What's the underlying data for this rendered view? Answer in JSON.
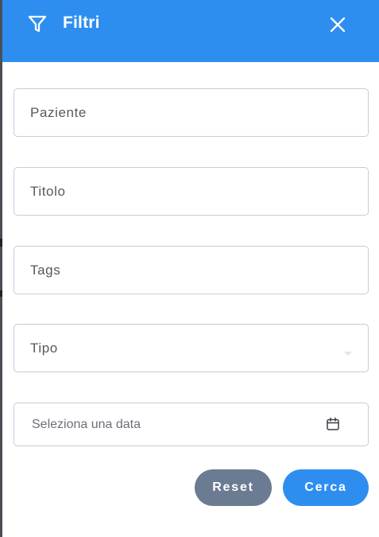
{
  "header": {
    "title": "Filtri",
    "filter_icon": "filter-icon",
    "close_icon": "close-icon",
    "background_color": "#2e8ef0"
  },
  "form": {
    "fields": [
      {
        "label": "Paziente",
        "kind": "text"
      },
      {
        "label": "Titolo",
        "kind": "text"
      },
      {
        "label": "Tags",
        "kind": "text"
      },
      {
        "label": "Tipo",
        "kind": "select"
      }
    ],
    "date": {
      "placeholder": "Seleziona una data",
      "icon": "calendar-icon"
    }
  },
  "actions": {
    "reset_label": "Reset",
    "search_label": "Cerca",
    "reset_color": "#6b7b92",
    "search_color": "#2e8ef0"
  }
}
